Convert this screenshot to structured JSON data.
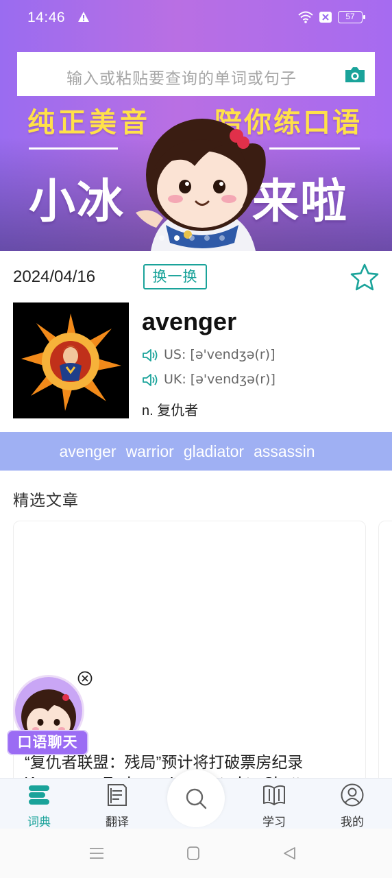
{
  "status_bar": {
    "time": "14:46",
    "battery": "57",
    "icons": [
      "warning-icon",
      "wifi-icon",
      "sim-off-icon",
      "battery-icon"
    ]
  },
  "search": {
    "placeholder": "输入或粘贴要查询的单词或句子",
    "camera_icon": "camera-icon"
  },
  "banner": {
    "line1_left": "纯正美音",
    "line1_right": "陪你练口语",
    "line2_left": "小冰",
    "line2_right": "来啦",
    "slides": 5,
    "active_slide": 2
  },
  "word_card": {
    "date": "2024/04/16",
    "swap_label": "换一换",
    "headword": "avenger",
    "us_pron": "US: [ə'vendʒə(r)]",
    "uk_pron": "UK: [ə'vendʒə(r)]",
    "definition": "n. 复仇者",
    "related": [
      "avenger",
      "warrior",
      "gladiator",
      "assassin"
    ]
  },
  "articles": {
    "section_title": "精选文章",
    "items": [
      {
        "title": "“复仇者联盟：残局”预计将打破票房纪录",
        "subtitle": "'Avengers: Endgame' expected to Shatter..."
      }
    ]
  },
  "float_widget": {
    "label": "口语聊天"
  },
  "bottom_nav": {
    "items": [
      {
        "label": "词典",
        "icon": "dictionary-icon",
        "active": true
      },
      {
        "label": "翻译",
        "icon": "translate-icon",
        "active": false
      },
      {
        "label": "学习",
        "icon": "book-icon",
        "active": false
      },
      {
        "label": "我的",
        "icon": "profile-icon",
        "active": false
      }
    ],
    "center_icon": "search-icon"
  },
  "colors": {
    "accent": "#1aa39a",
    "banner_purple": "#a66bf0",
    "related_bar": "#9fb0f3",
    "headline_yellow": "#ffe14a"
  }
}
